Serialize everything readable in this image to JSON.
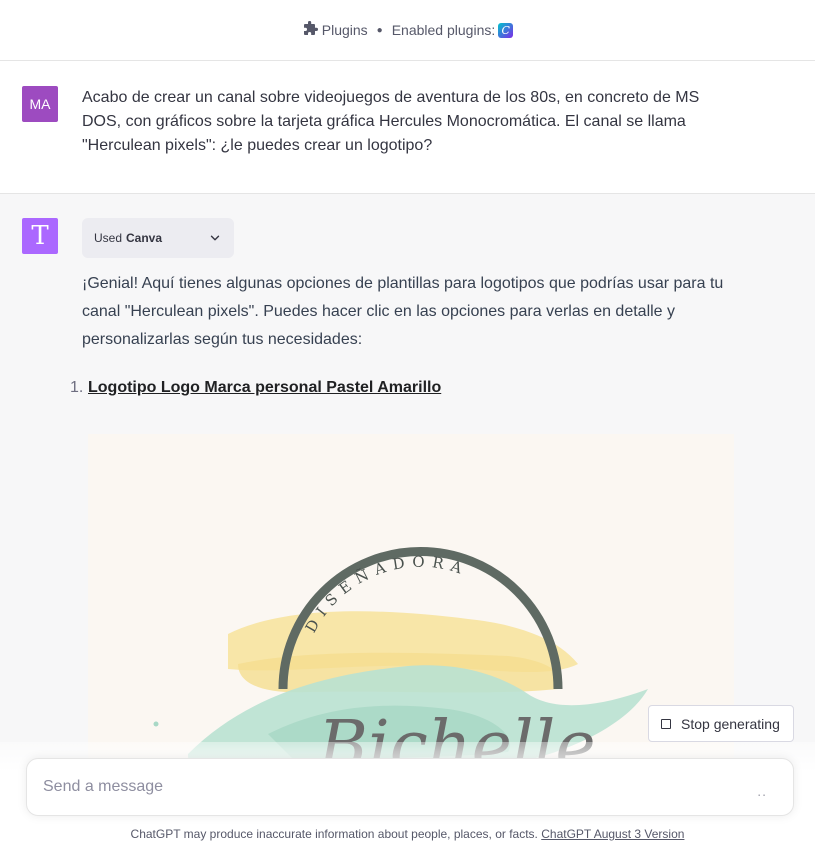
{
  "header": {
    "plugins_label": "Plugins",
    "enabled_label": "Enabled plugins:",
    "enabled_plugin_icon": "canva-icon"
  },
  "user_message": {
    "avatar_initials": "MA",
    "avatar_color": "#9d4bc0",
    "text": "Acabo de crear un canal sobre videojuegos de aventura de los 80s, en concreto de MS DOS, con gráficos sobre la tarjeta gráfica Hercules Monocromática. El canal se llama \"Herculean pixels\": ¿le puedes crear un logotipo?"
  },
  "assistant_message": {
    "avatar_glyph": "T",
    "avatar_color": "#ab68ff",
    "plugin_used_prefix": "Used",
    "plugin_used_name": "Canva",
    "text": "¡Genial! Aquí tienes algunas opciones de plantillas para logotipos que podrías usar para tu canal \"Herculean pixels\". Puedes hacer clic en las opciones para verlas en detalle y personalizarlas según tus necesidades:",
    "list": [
      {
        "number": "1.",
        "label": "Logotipo Logo Marca personal Pastel Amarillo"
      }
    ],
    "image": {
      "arc_text": "DISEÑADORA",
      "script_text": "Bichelle"
    }
  },
  "controls": {
    "stop_label": "Stop generating"
  },
  "composer": {
    "placeholder": "Send a message",
    "send_glyph": ".."
  },
  "footer": {
    "disclaimer": "ChatGPT may produce inaccurate information about people, places, or facts.",
    "version_link": "ChatGPT August 3 Version"
  }
}
